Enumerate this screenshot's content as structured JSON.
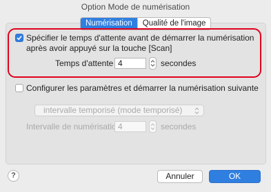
{
  "window": {
    "title": "Option Mode de numérisation"
  },
  "tabs": [
    {
      "label": "Numérisation",
      "active": true
    },
    {
      "label": "Qualité de l'image",
      "active": false
    }
  ],
  "wait_section": {
    "checked": true,
    "label_line1": "Spécifier le temps d'attente avant de démarrer la numérisation",
    "label_line2": "après avoir appuyé sur la touche [Scan]",
    "wait_time_label": "Temps d'attente :",
    "wait_time_value": "4",
    "unit": "secondes"
  },
  "next_scan_section": {
    "checked": false,
    "label": "Configurer les paramètres et démarrer la numérisation suivante",
    "mode_select_value": "intervalle temporisé (mode temporisé)",
    "interval_label": "Intervalle de numérisation :",
    "interval_value": "4",
    "unit": "secondes"
  },
  "footer": {
    "help_label": "?",
    "cancel_label": "Annuler",
    "ok_label": "OK"
  },
  "colors": {
    "accent": "#2f7fe0",
    "highlight_border": "#e0001b",
    "disabled_text": "#a9a9a9"
  }
}
